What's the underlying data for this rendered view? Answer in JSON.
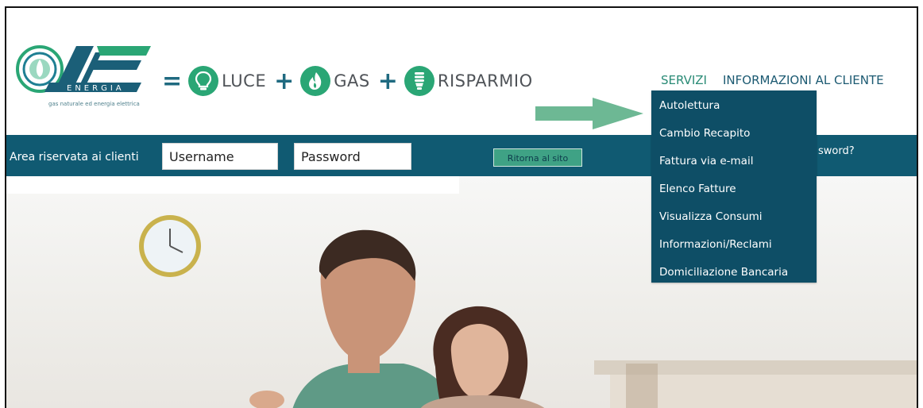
{
  "brand": {
    "tagline": "gas naturale ed energia elettrica",
    "logo_word": "ENERGIA",
    "colors": {
      "teal": "#2aa675",
      "navy": "#105a72",
      "dark": "#0e4e66"
    }
  },
  "slogan": {
    "equals": "=",
    "plus": "+",
    "items": [
      {
        "label": "LUCE",
        "icon": "lightbulb-icon"
      },
      {
        "label": "GAS",
        "icon": "flame-icon"
      },
      {
        "label": "RISPARMIO",
        "icon": "energy-saving-bulb-icon"
      }
    ]
  },
  "nav": {
    "items": [
      "SERVIZI",
      "INFORMAZIONI AL CLIENTE"
    ]
  },
  "login": {
    "label": "Area riservata ai clienti",
    "username_placeholder": "Username",
    "password_placeholder": "Password",
    "return_button": "Ritorna al sito",
    "forgot_partial": "sword?"
  },
  "dropdown": {
    "items": [
      "Autolettura",
      "Cambio Recapito",
      "Fattura via e-mail",
      "Elenco Fatture",
      "Visualizza Consumi",
      "Informazioni/Reclami",
      "Domiciliazione Bancaria"
    ]
  }
}
